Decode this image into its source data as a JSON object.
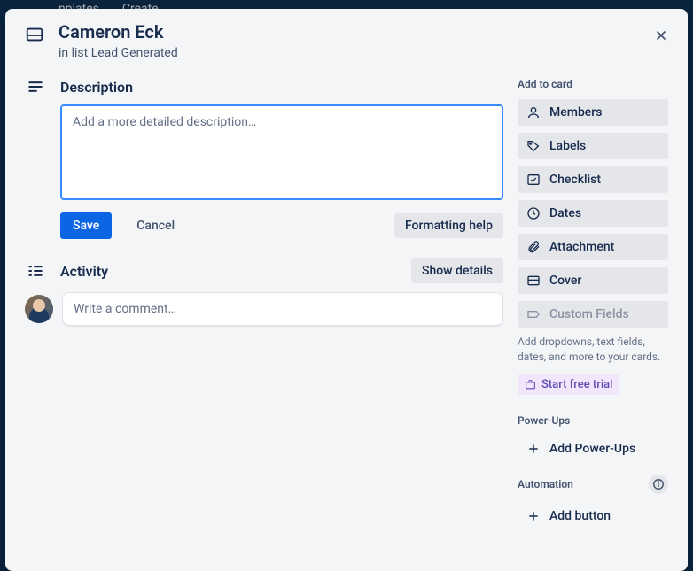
{
  "nav": {
    "item1": "nplates",
    "item2": "Create"
  },
  "header": {
    "title": "Cameron Eck",
    "subline_prefix": "in list ",
    "list_name": "Lead Generated"
  },
  "description": {
    "title": "Description",
    "placeholder": "Add a more detailed description…",
    "save": "Save",
    "cancel": "Cancel",
    "formatting_help": "Formatting help"
  },
  "activity": {
    "title": "Activity",
    "show_details": "Show details",
    "comment_placeholder": "Write a comment…"
  },
  "sidebar": {
    "add_to_card": "Add to card",
    "members": "Members",
    "labels": "Labels",
    "checklist": "Checklist",
    "dates": "Dates",
    "attachment": "Attachment",
    "cover": "Cover",
    "custom_fields": "Custom Fields",
    "custom_fields_note": "Add dropdowns, text fields, dates, and more to your cards.",
    "start_trial": "Start free trial",
    "power_ups": "Power-Ups",
    "add_power_ups": "Add Power-Ups",
    "automation": "Automation",
    "add_button": "Add button"
  }
}
